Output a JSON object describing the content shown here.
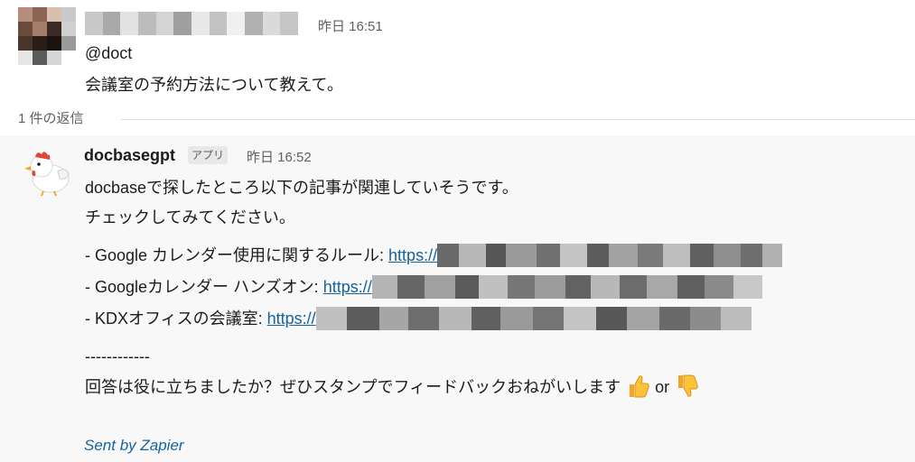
{
  "message1": {
    "time": "昨日 16:51",
    "mention": "@doct",
    "text": "会議室の予約方法について教えて。"
  },
  "thread": {
    "replies_label": "1 件の返信"
  },
  "message2": {
    "author": "docbasegpt",
    "badge": "アプリ",
    "time": "昨日 16:52",
    "line1": "docbaseで探したところ以下の記事が関連していそうです。",
    "line2": "チェックしてみてください。",
    "links": [
      {
        "prefix": "- Google カレンダー使用に関するルール: ",
        "url": "https://"
      },
      {
        "prefix": "- Googleカレンダー ハンズオン: ",
        "url": "https://"
      },
      {
        "prefix": "- KDXオフィスの会議室: ",
        "url": "https://"
      }
    ],
    "separator": "------------",
    "feedback": "回答は役に立ちましたか？ぜひスタンプでフィードバックおねがいします",
    "or_text": "or",
    "thumbs_up_icon": "thumbs-up-icon",
    "thumbs_down_icon": "thumbs-down-icon",
    "footer": "Sent by Zapier"
  },
  "colors": {
    "link": "#1264a3",
    "muted": "#616061",
    "thread_bg": "#f8f8f8"
  }
}
